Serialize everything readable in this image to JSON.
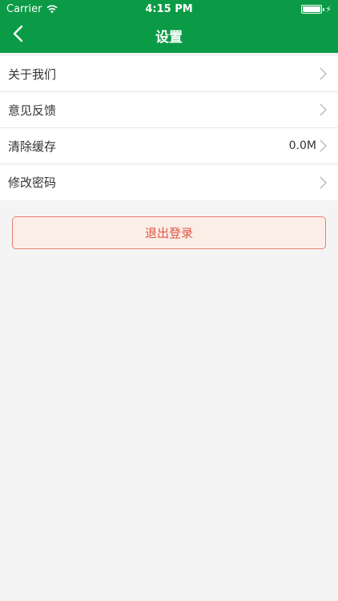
{
  "status_bar": {
    "carrier": "Carrier",
    "time": "4:15 PM",
    "wifi_icon": "wifi-icon",
    "battery_icon": "battery-icon",
    "charging_icon": "lightning-icon"
  },
  "nav": {
    "title": "设置",
    "back_icon": "chevron-left-icon",
    "background": "#0b9a46"
  },
  "settings": {
    "items": [
      {
        "label": "关于我们",
        "value": "",
        "icon": "chevron-right-icon"
      },
      {
        "label": "意见反馈",
        "value": "",
        "icon": "chevron-right-icon"
      },
      {
        "label": "清除缓存",
        "value": "0.0M",
        "icon": "chevron-right-icon"
      },
      {
        "label": "修改密码",
        "value": "",
        "icon": "chevron-right-icon"
      }
    ]
  },
  "logout": {
    "label": "退出登录",
    "text_color": "#e05545",
    "border_color": "#e87d73",
    "background": "#fbeee6"
  }
}
